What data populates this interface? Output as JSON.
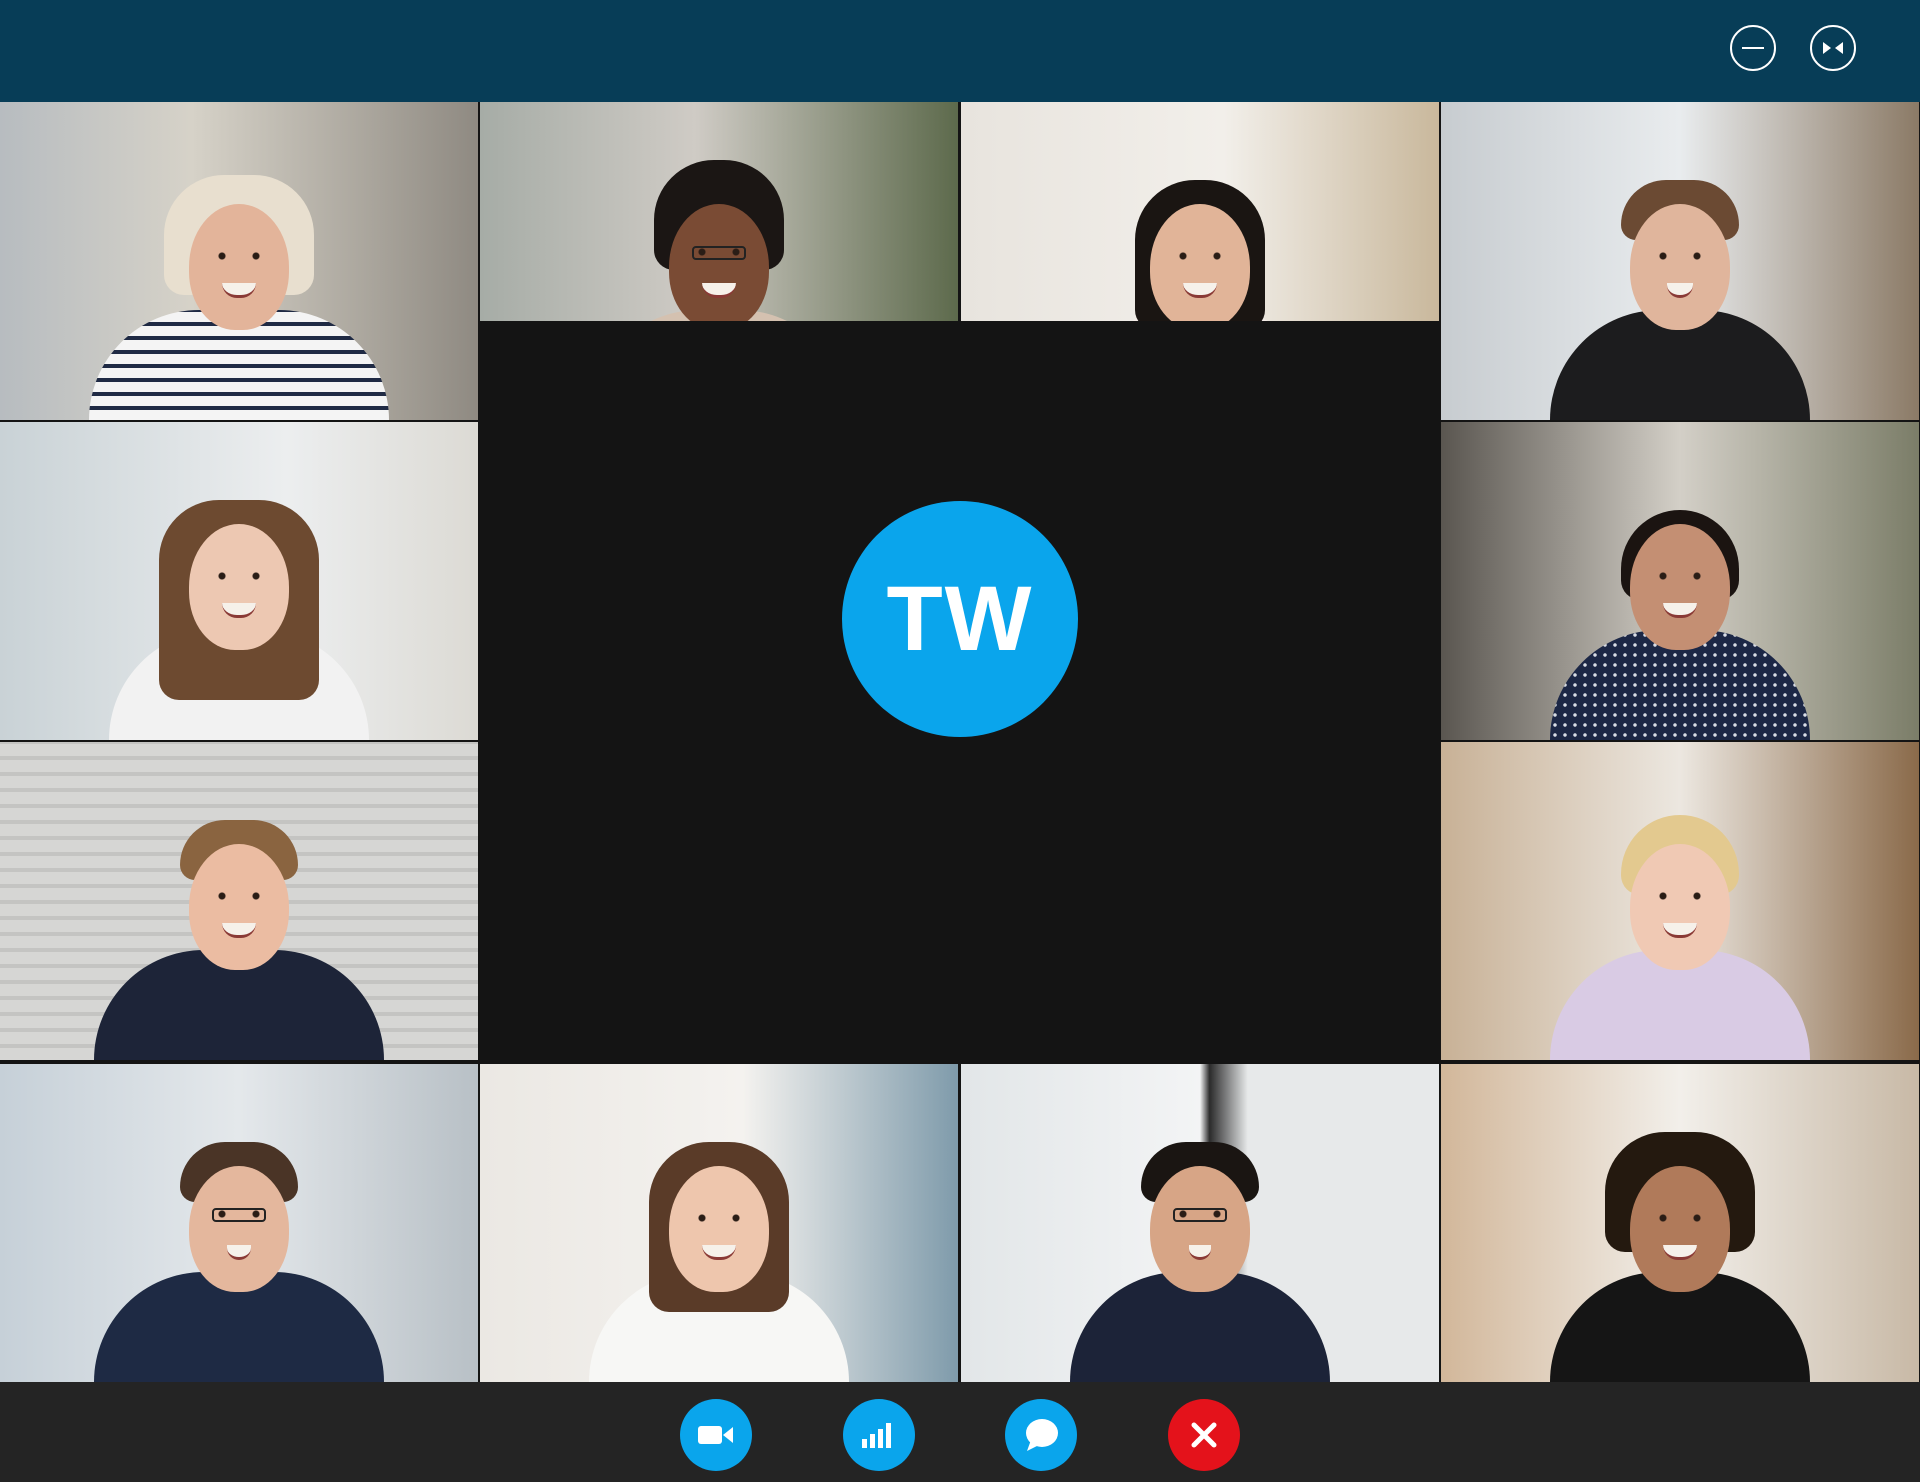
{
  "window_controls": [
    {
      "name": "minimize",
      "icon": "minimize-icon"
    },
    {
      "name": "restore",
      "icon": "restore-icon"
    }
  ],
  "spotlight": {
    "initials": "TW",
    "avatar_color": "#0aa5ec"
  },
  "participants": [
    {
      "description": "woman-white-hair-striped-shirt"
    },
    {
      "description": "woman-glasses-curly-hair"
    },
    {
      "description": "woman-long-black-hair-white-tshirt"
    },
    {
      "description": "man-headphones-suit"
    },
    {
      "description": "woman-brown-hair"
    },
    {
      "description": "woman-polka-dot-shirt"
    },
    {
      "description": "man-suit-tie"
    },
    {
      "description": "woman-blonde-lavender-shirt"
    },
    {
      "description": "man-glasses-blazer"
    },
    {
      "description": "woman-white-cardigan"
    },
    {
      "description": "man-glasses-dark-shirt"
    },
    {
      "description": "woman-curly-hair-black-top"
    }
  ],
  "controls": [
    {
      "name": "video",
      "icon": "video-camera-icon",
      "color": "#0aa5ec"
    },
    {
      "name": "stats",
      "icon": "signal-bars-icon",
      "color": "#0aa5ec"
    },
    {
      "name": "chat",
      "icon": "chat-bubble-icon",
      "color": "#0aa5ec"
    },
    {
      "name": "end-call",
      "icon": "close-icon",
      "color": "#e4121b"
    }
  ],
  "colors": {
    "topbar": "#073d57",
    "control_bar": "#242424",
    "spotlight_bg": "#141414",
    "accent": "#0aa5ec",
    "danger": "#e4121b"
  }
}
